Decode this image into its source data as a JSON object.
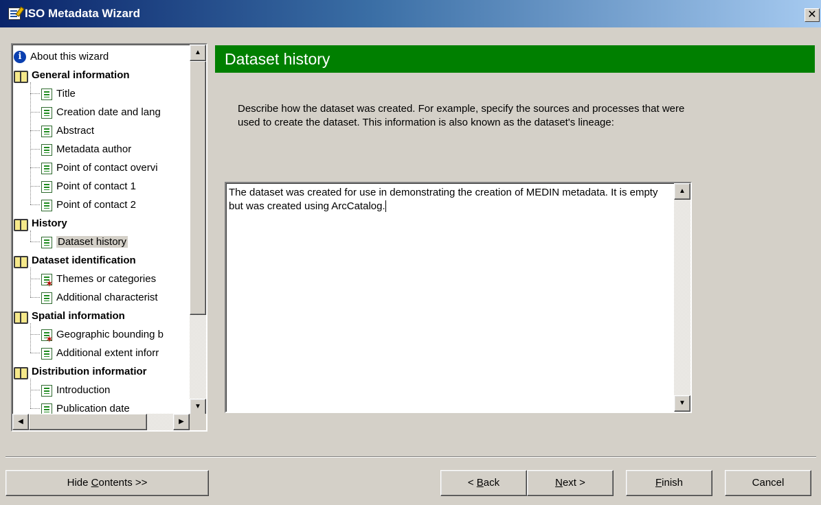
{
  "window": {
    "title": "ISO Metadata Wizard",
    "close_glyph": "✕"
  },
  "tree": {
    "items": [
      {
        "label": "About this wizard",
        "kind": "info",
        "level": 0
      },
      {
        "label": "General information",
        "kind": "book",
        "level": 0
      },
      {
        "label": "Title",
        "kind": "page",
        "level": 1
      },
      {
        "label": "Creation date and lang",
        "kind": "page",
        "level": 1
      },
      {
        "label": "Abstract",
        "kind": "page",
        "level": 1
      },
      {
        "label": "Metadata author",
        "kind": "page",
        "level": 1
      },
      {
        "label": "Point of contact overvi",
        "kind": "page",
        "level": 1
      },
      {
        "label": "Point of contact 1",
        "kind": "page",
        "level": 1
      },
      {
        "label": "Point of contact 2",
        "kind": "page",
        "level": 1
      },
      {
        "label": "History",
        "kind": "book",
        "level": 0
      },
      {
        "label": "Dataset history",
        "kind": "page",
        "level": 1,
        "selected": true
      },
      {
        "label": "Dataset identification",
        "kind": "book",
        "level": 0
      },
      {
        "label": "Themes or categories",
        "kind": "page-required",
        "level": 1
      },
      {
        "label": "Additional characterist",
        "kind": "page",
        "level": 1
      },
      {
        "label": "Spatial information",
        "kind": "book",
        "level": 0
      },
      {
        "label": "Geographic bounding b",
        "kind": "page-required",
        "level": 1
      },
      {
        "label": "Additional extent inforr",
        "kind": "page",
        "level": 1
      },
      {
        "label": "Distribution informatior",
        "kind": "book",
        "level": 0
      },
      {
        "label": "Introduction",
        "kind": "page",
        "level": 1
      },
      {
        "label": "Publication date",
        "kind": "page",
        "level": 1
      }
    ]
  },
  "page": {
    "heading": "Dataset history",
    "description": "Describe how the dataset was created.  For example, specify the sources and processes that were used to create the dataset.  This information is also known as the dataset's lineage:",
    "history_value": "The dataset was created for use in demonstrating the creation of MEDIN metadata. It is empty but was created using ArcCatalog."
  },
  "buttons": {
    "hide_contents_pre": "Hide ",
    "hide_contents_key": "C",
    "hide_contents_post": "ontents >>",
    "back_pre": "< ",
    "back_key": "B",
    "back_post": "ack",
    "next_key": "N",
    "next_post": "ext >",
    "finish_key": "F",
    "finish_post": "inish",
    "cancel": "Cancel"
  }
}
